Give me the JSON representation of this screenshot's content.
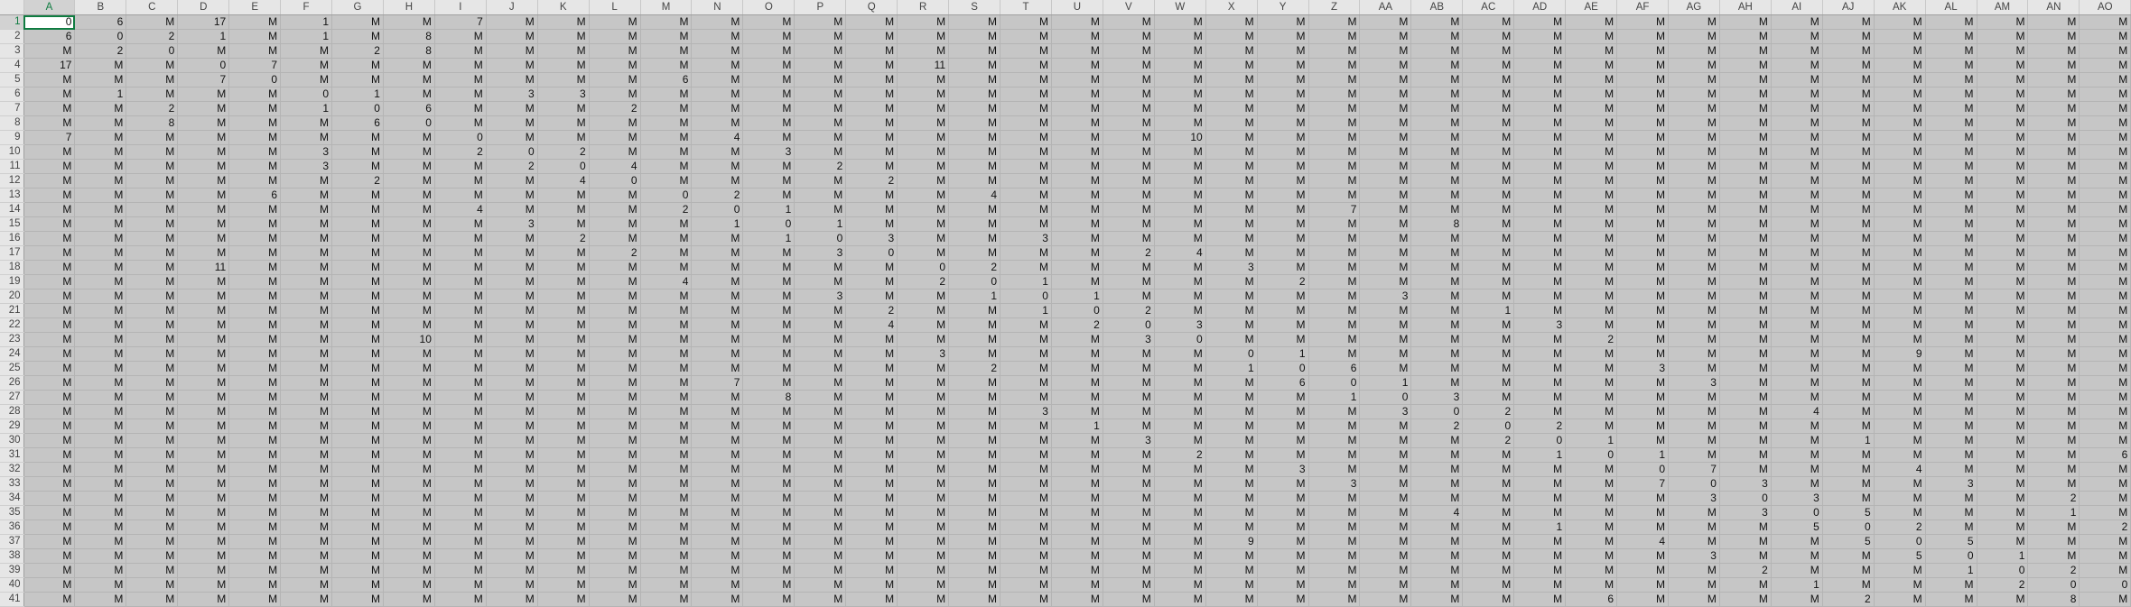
{
  "sheet": {
    "columns": [
      "A",
      "B",
      "C",
      "D",
      "E",
      "F",
      "G",
      "H",
      "I",
      "J",
      "K",
      "L",
      "M",
      "N",
      "O",
      "P",
      "Q",
      "R",
      "S",
      "T",
      "U",
      "V",
      "W",
      "X",
      "Y",
      "Z",
      "AA",
      "AB",
      "AC",
      "AD",
      "AE",
      "AF",
      "AG",
      "AH",
      "AI",
      "AJ",
      "AK",
      "AL",
      "AM",
      "AN",
      "AO"
    ],
    "row_numbers": [
      "1",
      "2",
      "3",
      "4",
      "5",
      "6",
      "7",
      "8",
      "9",
      "10",
      "11",
      "12",
      "13",
      "14",
      "15",
      "16",
      "17",
      "18",
      "19",
      "20",
      "21",
      "22",
      "23",
      "24",
      "25",
      "26",
      "27",
      "28",
      "29",
      "30",
      "31",
      "32",
      "33",
      "34",
      "35",
      "36",
      "37",
      "38",
      "39",
      "40",
      "41"
    ],
    "active_cell": "A1",
    "missing_token": "M",
    "sparse_values": {
      "1": {
        "A": "0",
        "B": "6",
        "D": "17",
        "F": "1",
        "I": "7"
      },
      "2": {
        "A": "6",
        "B": "0",
        "C": "2",
        "D": "1",
        "F": "1",
        "H": "8"
      },
      "3": {
        "B": "2",
        "C": "0",
        "G": "2",
        "H": "8"
      },
      "4": {
        "A": "17",
        "D": "0",
        "E": "7",
        "R": "11"
      },
      "5": {
        "D": "7",
        "E": "0",
        "M": "6"
      },
      "6": {
        "B": "1",
        "F": "0",
        "G": "1",
        "J": "3",
        "K": "3"
      },
      "7": {
        "C": "2",
        "F": "1",
        "G": "0",
        "H": "6",
        "L": "2"
      },
      "8": {
        "C": "8",
        "G": "6",
        "H": "0"
      },
      "9": {
        "A": "7",
        "I": "0",
        "N": "4",
        "W": "10"
      },
      "10": {
        "F": "3",
        "I": "2",
        "J": "0",
        "K": "2",
        "O": "3"
      },
      "11": {
        "F": "3",
        "J": "2",
        "K": "0",
        "L": "4",
        "P": "2"
      },
      "12": {
        "G": "2",
        "K": "4",
        "L": "0",
        "Q": "2"
      },
      "13": {
        "E": "6",
        "M": "0",
        "N": "2",
        "S": "4"
      },
      "14": {
        "I": "4",
        "M": "2",
        "N": "0",
        "O": "1",
        "Z": "7"
      },
      "15": {
        "J": "3",
        "N": "1",
        "O": "0",
        "P": "1",
        "AB": "8"
      },
      "16": {
        "K": "2",
        "O": "1",
        "P": "0",
        "Q": "3",
        "T": "3"
      },
      "17": {
        "L": "2",
        "P": "3",
        "Q": "0",
        "V": "2",
        "W": "4"
      },
      "18": {
        "D": "11",
        "R": "0",
        "S": "2",
        "X": "3"
      },
      "19": {
        "M": "4",
        "R": "2",
        "S": "0",
        "T": "1",
        "Y": "2"
      },
      "20": {
        "P": "3",
        "S": "1",
        "T": "0",
        "U": "1",
        "AA": "3"
      },
      "21": {
        "Q": "2",
        "T": "1",
        "U": "0",
        "V": "2",
        "AC": "1"
      },
      "22": {
        "Q": "4",
        "U": "2",
        "V": "0",
        "W": "3",
        "AD": "3"
      },
      "23": {
        "H": "10",
        "V": "3",
        "W": "0",
        "AE": "2"
      },
      "24": {
        "R": "3",
        "X": "0",
        "Y": "1",
        "AK": "9"
      },
      "25": {
        "S": "2",
        "X": "1",
        "Y": "0",
        "Z": "6",
        "AF": "3"
      },
      "26": {
        "N": "7",
        "Y": "6",
        "Z": "0",
        "AA": "1",
        "AG": "3"
      },
      "27": {
        "O": "8",
        "Z": "1",
        "AA": "0",
        "AB": "3"
      },
      "28": {
        "T": "3",
        "AA": "3",
        "AB": "0",
        "AC": "2",
        "AI": "4"
      },
      "29": {
        "U": "1",
        "AB": "2",
        "AC": "0",
        "AD": "2"
      },
      "30": {
        "V": "3",
        "AC": "2",
        "AD": "0",
        "AE": "1",
        "AJ": "1"
      },
      "31": {
        "W": "2",
        "AD": "1",
        "AE": "0",
        "AF": "1",
        "AO": "6"
      },
      "32": {
        "Y": "3",
        "AF": "0",
        "AG": "7",
        "AK": "4"
      },
      "33": {
        "Z": "3",
        "AF": "7",
        "AG": "0",
        "AH": "3",
        "AL": "3"
      },
      "34": {
        "AG": "3",
        "AH": "0",
        "AI": "3",
        "AN": "2"
      },
      "35": {
        "AB": "4",
        "AH": "3",
        "AI": "0",
        "AJ": "5",
        "AN": "1"
      },
      "36": {
        "AD": "1",
        "AI": "5",
        "AJ": "0",
        "AK": "2",
        "AO": "2"
      },
      "37": {
        "X": "9",
        "AF": "4",
        "AJ": "5",
        "AK": "0",
        "AL": "5"
      },
      "38": {
        "AG": "3",
        "AK": "5",
        "AL": "0",
        "AM": "1"
      },
      "39": {
        "AH": "2",
        "AL": "1",
        "AM": "0",
        "AN": "2"
      },
      "40": {
        "AI": "1",
        "AM": "2",
        "AN": "0",
        "AO": "0"
      },
      "41": {
        "AE": "6",
        "AJ": "2",
        "AN": "8"
      }
    }
  },
  "colors": {
    "cell_background": "#c6c6c6",
    "header_background": "#e6e6e6",
    "active_border": "#107c41"
  }
}
